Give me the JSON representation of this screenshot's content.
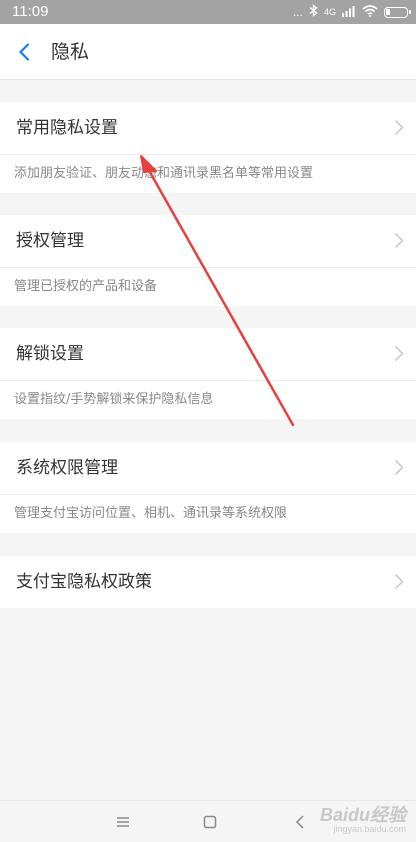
{
  "status_bar": {
    "time": "11:09",
    "dots": "...",
    "network_label": "4G",
    "battery_level": 0.2
  },
  "header": {
    "title": "隐私"
  },
  "sections": [
    {
      "title": "常用隐私设置",
      "desc": "添加朋友验证、朋友动态和通讯录黑名单等常用设置"
    },
    {
      "title": "授权管理",
      "desc": "管理已授权的产品和设备"
    },
    {
      "title": "解锁设置",
      "desc": "设置指纹/手势解锁来保护隐私信息"
    },
    {
      "title": "系统权限管理",
      "desc": "管理支付宝访问位置、相机、通讯录等系统权限"
    },
    {
      "title": "支付宝隐私权政策"
    }
  ],
  "watermark": {
    "brand": "Baidu经验",
    "url": "jingyan.baidu.com"
  },
  "colors": {
    "accent": "#1677ff",
    "annotation_arrow": "#e8403c",
    "status_bar_bg": "#a3a3a3",
    "page_bg": "#f5f5f5"
  },
  "icons": {
    "back": "chevron-left-icon",
    "row_arrow": "chevron-right-icon",
    "bluetooth": "bluetooth-icon",
    "signal": "signal-icon",
    "wifi": "wifi-icon",
    "battery": "battery-icon",
    "nav_menu": "menu-icon",
    "nav_home": "home-square-icon",
    "nav_back": "back-triangle-icon"
  }
}
